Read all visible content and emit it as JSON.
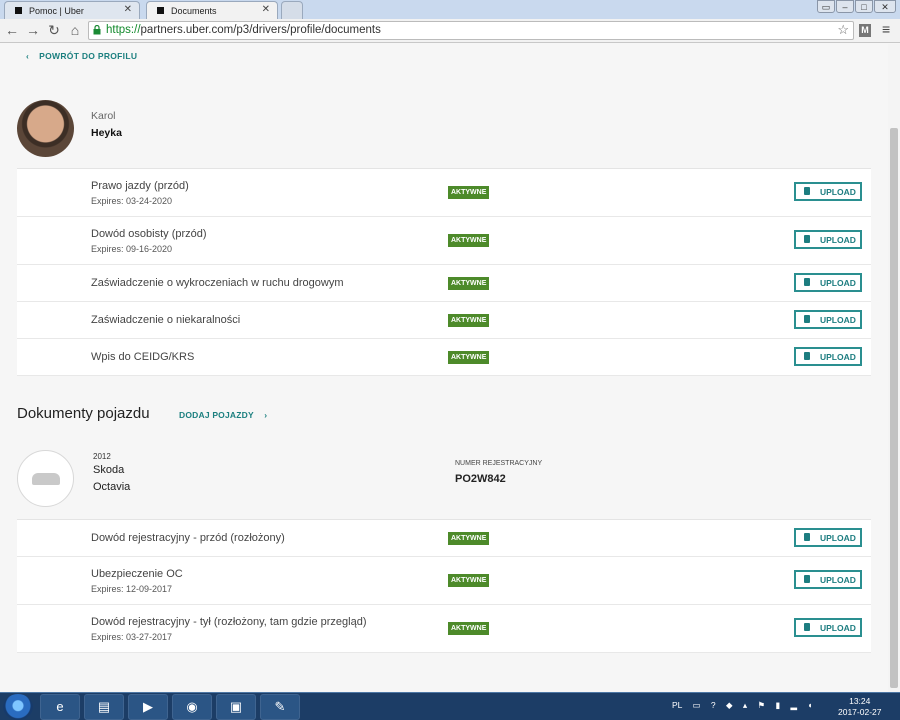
{
  "browser": {
    "tabs": [
      {
        "title": "Pomoc | Uber"
      },
      {
        "title": "Documents"
      }
    ],
    "address_https": "https://",
    "address_rest": "partners.uber.com/p3/drivers/profile/documents",
    "extension_label": "M"
  },
  "page": {
    "back_link": "POWRÓT DO PROFILU",
    "driver": {
      "first_name": "Karol",
      "last_name": "Heyka"
    },
    "driver_documents": [
      {
        "name": "Prawo jazdy (przód)",
        "expires": "Expires: 03-24-2020",
        "status": "AKTYWNE",
        "action": "UPLOAD"
      },
      {
        "name": "Dowód osobisty (przód)",
        "expires": "Expires: 09-16-2020",
        "status": "AKTYWNE",
        "action": "UPLOAD"
      },
      {
        "name": "Zaświadczenie o wykroczeniach w ruchu drogowym",
        "expires": "",
        "status": "AKTYWNE",
        "action": "UPLOAD"
      },
      {
        "name": "Zaświadczenie o niekaralności",
        "expires": "",
        "status": "AKTYWNE",
        "action": "UPLOAD"
      },
      {
        "name": "Wpis do CEIDG/KRS",
        "expires": "",
        "status": "AKTYWNE",
        "action": "UPLOAD"
      }
    ],
    "vehicle_section_title": "Dokumenty pojazdu",
    "add_vehicle_link": "DODAJ POJAZDY",
    "vehicle": {
      "year": "2012",
      "make": "Skoda",
      "model": "Octavia",
      "plate_label": "NUMER REJESTRACYJNY",
      "plate": "PO2W842"
    },
    "vehicle_documents": [
      {
        "name": "Dowód rejestracyjny - przód (rozłożony)",
        "expires": "",
        "status": "AKTYWNE",
        "action": "UPLOAD"
      },
      {
        "name": "Ubezpieczenie OC",
        "expires": "Expires: 12-09-2017",
        "status": "AKTYWNE",
        "action": "UPLOAD"
      },
      {
        "name": "Dowód rejestracyjny - tył (rozłożony, tam gdzie przegląd)",
        "expires": "Expires: 03-27-2017",
        "status": "AKTYWNE",
        "action": "UPLOAD"
      }
    ]
  },
  "taskbar": {
    "language": "PL",
    "time": "13:24",
    "date": "2017-02-27"
  },
  "colors": {
    "accent": "#1b7f7f",
    "status_active": "#4d8a2a",
    "taskbar": "#1c3d66"
  }
}
